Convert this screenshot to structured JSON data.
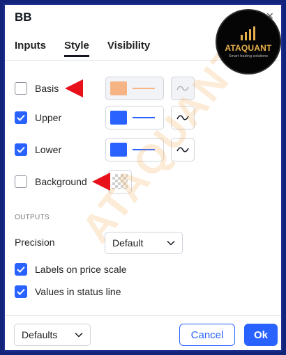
{
  "dialog": {
    "title": "BB"
  },
  "tabs": [
    {
      "label": "Inputs",
      "active": false
    },
    {
      "label": "Style",
      "active": true
    },
    {
      "label": "Visibility",
      "active": false
    }
  ],
  "style_rows": [
    {
      "label": "Basis",
      "checked": false,
      "color": "#f6b384",
      "disabled": true
    },
    {
      "label": "Upper",
      "checked": true,
      "color": "#2962ff",
      "disabled": false
    },
    {
      "label": "Lower",
      "checked": true,
      "color": "#2962ff",
      "disabled": false
    },
    {
      "label": "Background",
      "checked": false,
      "disabled": false
    }
  ],
  "outputs": {
    "section_label": "OUTPUTS",
    "precision_label": "Precision",
    "precision_value": "Default",
    "labels_on_price_scale": {
      "label": "Labels on price scale",
      "checked": true
    },
    "values_in_status_line": {
      "label": "Values in status line",
      "checked": true
    }
  },
  "footer": {
    "defaults_label": "Defaults",
    "cancel_label": "Cancel",
    "ok_label": "Ok"
  },
  "logo": {
    "name": "ATAQUANT",
    "tagline": "Smart trading solutions"
  },
  "watermark": "ATAQUANT",
  "colors": {
    "accent": "#2962ff",
    "annotation_arrow": "#e8101b",
    "logo_gold": "#e7b04d"
  }
}
